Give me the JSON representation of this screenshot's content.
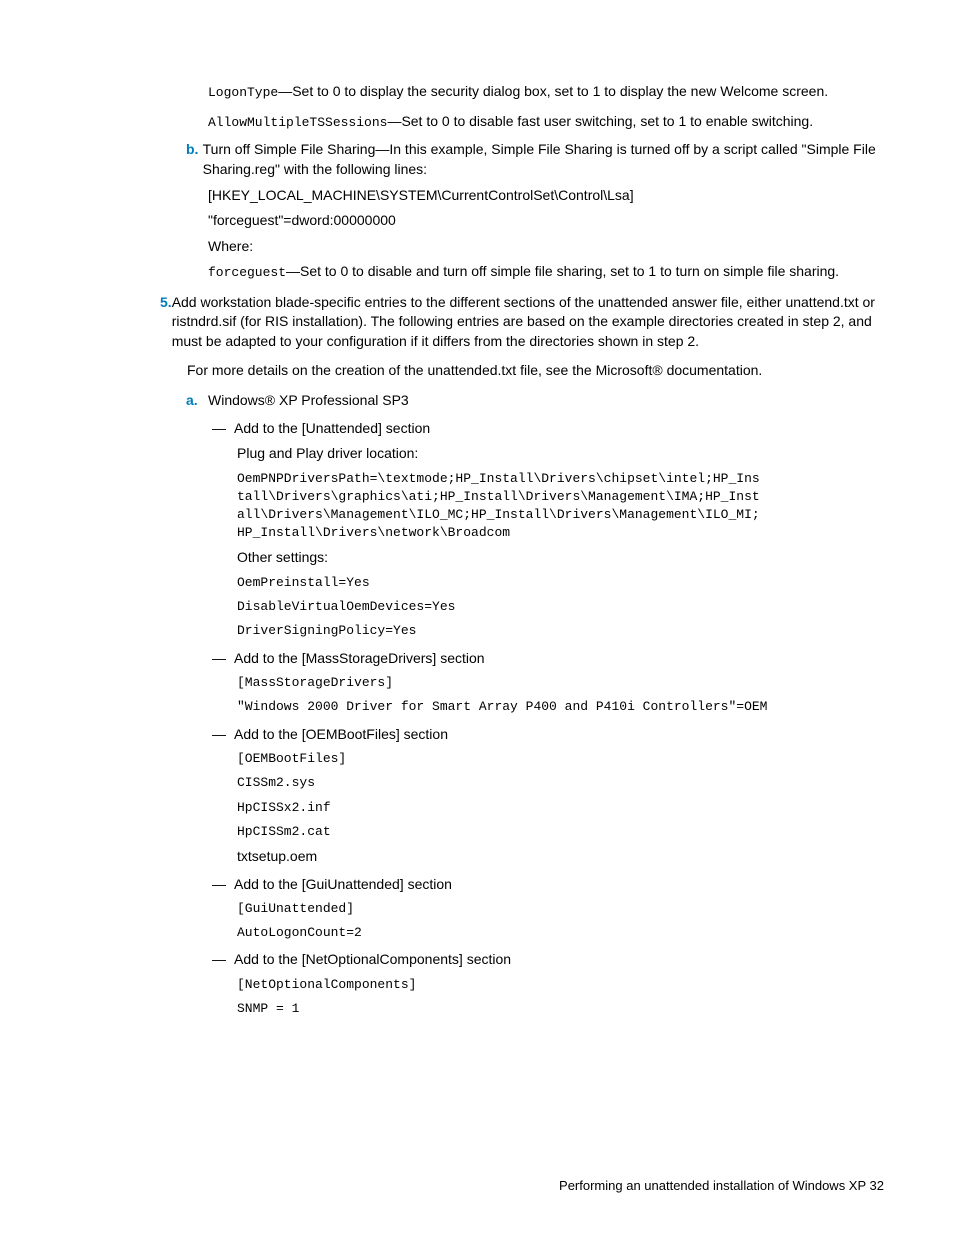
{
  "p1a": "LogonType",
  "p1b": "—Set to 0 to display the security dialog box, set to 1 to display the new Welcome screen.",
  "p2a": "AllowMultipleTSSessions",
  "p2b": "—Set to 0 to disable fast user switching, set to 1 to enable switching.",
  "bmarker": "b.",
  "p3": "Turn off Simple File Sharing—In this example, Simple File Sharing is turned off by a script called \"Simple File Sharing.reg\" with the following lines:",
  "p4": " [HKEY_LOCAL_MACHINE\\SYSTEM\\CurrentControlSet\\Control\\Lsa]",
  "p5": "\"forceguest\"=dword:00000000",
  "p6": "Where:",
  "p7a": "forceguest",
  "p7b": "—Set to 0 to disable and turn off simple file sharing, set to 1 to turn on simple file sharing.",
  "marker5": "5.",
  "p8": "Add workstation blade-specific entries to the different sections of the unattended answer file, either unattend.txt or ristndrd.sif (for RIS installation). The following entries are based on the example directories created in step 2, and must be adapted to your configuration if it differs from the directories shown in step 2.",
  "p9": "For more details on the creation of the unattended.txt file, see the Microsoft® documentation.",
  "amarker": "a.",
  "p10": "Windows® XP Professional SP3",
  "dash": "—",
  "s1": "Add to the [Unattended] section",
  "s1a": "Plug and Play driver location:",
  "code1": "OemPNPDriversPath=\\textmode;HP_Install\\Drivers\\chipset\\intel;HP_Ins\ntall\\Drivers\\graphics\\ati;HP_Install\\Drivers\\Management\\IMA;HP_Inst\nall\\Drivers\\Management\\ILO_MC;HP_Install\\Drivers\\Management\\ILO_MI;\nHP_Install\\Drivers\\network\\Broadcom",
  "s1b": "Other settings:",
  "code2": "OemPreinstall=Yes",
  "code3": "DisableVirtualOemDevices=Yes",
  "code4": "DriverSigningPolicy=Yes",
  "s2": "Add to the [MassStorageDrivers] section",
  "code5": "[MassStorageDrivers]",
  "code6": "\"Windows 2000 Driver for Smart Array P400 and P410i Controllers\"=OEM",
  "s3": "Add to the [OEMBootFiles] section",
  "code7": "[OEMBootFiles]",
  "code8": "CISSm2.sys",
  "code9": "HpCISSx2.inf",
  "code10": "HpCISSm2.cat",
  "s3a": "txtsetup.oem",
  "s4": "Add to the [GuiUnattended] section",
  "code11": "[GuiUnattended]",
  "code12": "AutoLogonCount=2",
  "s5": "Add to the [NetOptionalComponents] section",
  "code13": "[NetOptionalComponents]",
  "code14": "SNMP = 1",
  "footer": "Performing an unattended installation of Windows XP   32"
}
